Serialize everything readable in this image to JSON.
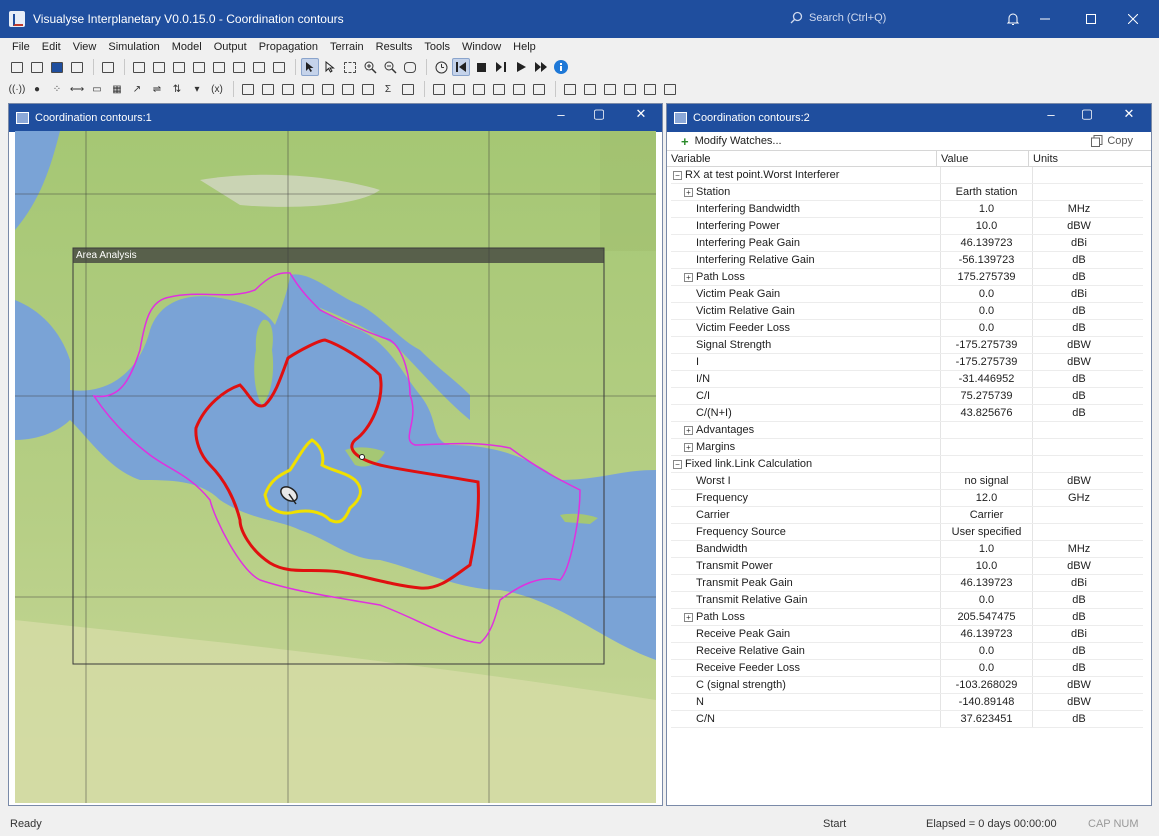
{
  "app": {
    "title": "Visualyse Interplanetary V0.0.15.0 - Coordination contours",
    "search_placeholder": "Search (Ctrl+Q)"
  },
  "menu": [
    "File",
    "Edit",
    "View",
    "Simulation",
    "Model",
    "Output",
    "Propagation",
    "Terrain",
    "Results",
    "Tools",
    "Window",
    "Help"
  ],
  "left_panel": {
    "title": "Coordination contours:1",
    "area_label": "Area Analysis"
  },
  "right_panel": {
    "title": "Coordination contours:2",
    "modify_label": "Modify Watches...",
    "copy_label": "Copy",
    "columns": [
      "Variable",
      "Value",
      "Units"
    ],
    "rows": [
      {
        "label": "RX at test point.Worst Interferer",
        "value": "",
        "units": "",
        "level": 0,
        "expander": "minus"
      },
      {
        "label": "Station",
        "value": "Earth station",
        "units": "",
        "level": 1,
        "expander": "plus"
      },
      {
        "label": "Interfering Bandwidth",
        "value": "1.0",
        "units": "MHz",
        "level": 1,
        "expander": ""
      },
      {
        "label": "Interfering Power",
        "value": "10.0",
        "units": "dBW",
        "level": 1,
        "expander": ""
      },
      {
        "label": "Interfering Peak Gain",
        "value": "46.139723",
        "units": "dBi",
        "level": 1,
        "expander": ""
      },
      {
        "label": "Interfering Relative Gain",
        "value": "-56.139723",
        "units": "dB",
        "level": 1,
        "expander": ""
      },
      {
        "label": "Path Loss",
        "value": "175.275739",
        "units": "dB",
        "level": 1,
        "expander": "plus"
      },
      {
        "label": "Victim Peak Gain",
        "value": "0.0",
        "units": "dBi",
        "level": 1,
        "expander": ""
      },
      {
        "label": "Victim Relative Gain",
        "value": "0.0",
        "units": "dB",
        "level": 1,
        "expander": ""
      },
      {
        "label": "Victim Feeder Loss",
        "value": "0.0",
        "units": "dB",
        "level": 1,
        "expander": ""
      },
      {
        "label": "Signal Strength",
        "value": "-175.275739",
        "units": "dBW",
        "level": 1,
        "expander": ""
      },
      {
        "label": "I",
        "value": "-175.275739",
        "units": "dBW",
        "level": 1,
        "expander": ""
      },
      {
        "label": "I/N",
        "value": "-31.446952",
        "units": "dB",
        "level": 1,
        "expander": ""
      },
      {
        "label": "C/I",
        "value": "75.275739",
        "units": "dB",
        "level": 1,
        "expander": ""
      },
      {
        "label": "C/(N+I)",
        "value": "43.825676",
        "units": "dB",
        "level": 1,
        "expander": ""
      },
      {
        "label": "Advantages",
        "value": "",
        "units": "",
        "level": 1,
        "expander": "plus"
      },
      {
        "label": "Margins",
        "value": "",
        "units": "",
        "level": 1,
        "expander": "plus"
      },
      {
        "label": "Fixed link.Link Calculation",
        "value": "",
        "units": "",
        "level": 0,
        "expander": "minus"
      },
      {
        "label": "Worst I",
        "value": "no signal",
        "units": "dBW",
        "level": 1,
        "expander": ""
      },
      {
        "label": "Frequency",
        "value": "12.0",
        "units": "GHz",
        "level": 1,
        "expander": ""
      },
      {
        "label": "Carrier",
        "value": "Carrier",
        "units": "",
        "level": 1,
        "expander": ""
      },
      {
        "label": "Frequency Source",
        "value": "User specified",
        "units": "",
        "level": 1,
        "expander": ""
      },
      {
        "label": "Bandwidth",
        "value": "1.0",
        "units": "MHz",
        "level": 1,
        "expander": ""
      },
      {
        "label": "Transmit Power",
        "value": "10.0",
        "units": "dBW",
        "level": 1,
        "expander": ""
      },
      {
        "label": "Transmit Peak Gain",
        "value": "46.139723",
        "units": "dBi",
        "level": 1,
        "expander": ""
      },
      {
        "label": "Transmit Relative Gain",
        "value": "0.0",
        "units": "dB",
        "level": 1,
        "expander": ""
      },
      {
        "label": "Path Loss",
        "value": "205.547475",
        "units": "dB",
        "level": 1,
        "expander": "plus"
      },
      {
        "label": "Receive Peak Gain",
        "value": "46.139723",
        "units": "dBi",
        "level": 1,
        "expander": ""
      },
      {
        "label": "Receive Relative Gain",
        "value": "0.0",
        "units": "dB",
        "level": 1,
        "expander": ""
      },
      {
        "label": "Receive Feeder Loss",
        "value": "0.0",
        "units": "dB",
        "level": 1,
        "expander": ""
      },
      {
        "label": "C (signal strength)",
        "value": "-103.268029",
        "units": "dBW",
        "level": 1,
        "expander": ""
      },
      {
        "label": "N",
        "value": "-140.89148",
        "units": "dBW",
        "level": 1,
        "expander": ""
      },
      {
        "label": "C/N",
        "value": "37.623451",
        "units": "dB",
        "level": 1,
        "expander": ""
      }
    ]
  },
  "status": {
    "left": "Ready",
    "mid": "Start",
    "elapsed": "Elapsed = 0 days 00:00:00",
    "keys": "CAP NUM"
  },
  "colors": {
    "titlebar": "#1f4e9e",
    "sea": "#7aa3d6",
    "contour_outer": "#e030e0",
    "contour_mid": "#e01010",
    "contour_inner": "#f0e000"
  }
}
